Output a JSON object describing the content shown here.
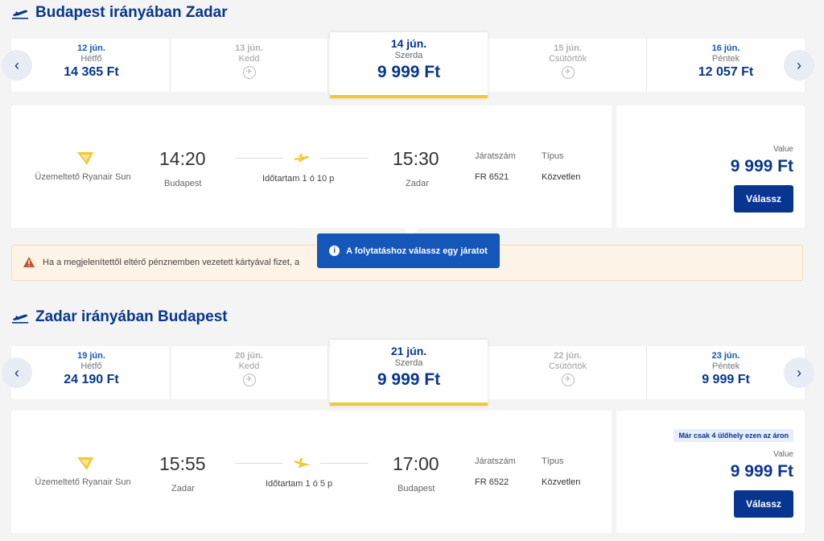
{
  "outbound": {
    "title": "Budapest irányában Zadar",
    "days": [
      {
        "date": "12 jún.",
        "weekday": "Hétfő",
        "price": "14 365 Ft"
      },
      {
        "date": "13 jún.",
        "weekday": "Kedd",
        "price": ""
      },
      {
        "date": "14 jún.",
        "weekday": "Szerda",
        "price": "9 999 Ft"
      },
      {
        "date": "15 jún.",
        "weekday": "Csütörtök",
        "price": ""
      },
      {
        "date": "16 jún.",
        "weekday": "Péntek",
        "price": "12 057 Ft"
      }
    ],
    "flight": {
      "operator": "Üzemeltető Ryanair Sun",
      "dep_time": "14:20",
      "dep_city": "Budapest",
      "duration": "Időtartam 1 ó 10 p",
      "arr_time": "15:30",
      "arr_city": "Zadar",
      "flight_no_label": "Járatszám",
      "flight_no": "FR 6521",
      "type_label": "Típus",
      "type": "Közvetlen",
      "value_label": "Value",
      "price": "9 999 Ft",
      "button": "Válassz"
    }
  },
  "warning": {
    "text": "Ha a megjelenítettől eltérő pénznemben vezetett kártyával fizet, a"
  },
  "tooltip": {
    "text": "A folytatáshoz válassz egy járatot"
  },
  "inbound": {
    "title": "Zadar irányában Budapest",
    "days": [
      {
        "date": "19 jún.",
        "weekday": "Hétfő",
        "price": "24 190 Ft"
      },
      {
        "date": "20 jún.",
        "weekday": "Kedd",
        "price": ""
      },
      {
        "date": "21 jún.",
        "weekday": "Szerda",
        "price": "9 999 Ft"
      },
      {
        "date": "22 jún.",
        "weekday": "Csütörtök",
        "price": ""
      },
      {
        "date": "23 jún.",
        "weekday": "Péntek",
        "price": "9 999 Ft"
      }
    ],
    "flight": {
      "operator": "Üzemeltető Ryanair Sun",
      "dep_time": "15:55",
      "dep_city": "Zadar",
      "duration": "Időtartam 1 ó 5 p",
      "arr_time": "17:00",
      "arr_city": "Budapest",
      "flight_no_label": "Járatszám",
      "flight_no": "FR 6522",
      "type_label": "Típus",
      "type": "Közvetlen",
      "seats_badge": "Már csak 4 ülőhely ezen az áron",
      "value_label": "Value",
      "price": "9 999 Ft",
      "button": "Válassz"
    }
  },
  "colors": {
    "brand": "#073590",
    "accent": "#f1c933",
    "link": "#1557b8",
    "warning": "#c0532b"
  }
}
